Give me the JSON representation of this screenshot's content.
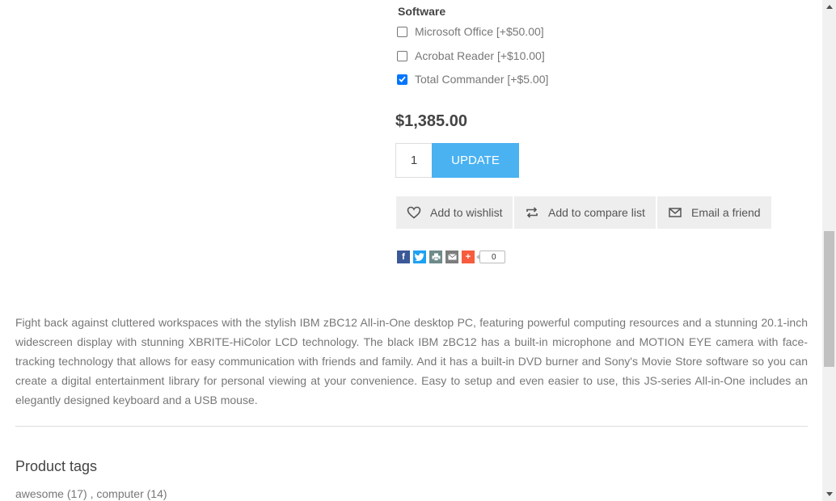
{
  "software": {
    "title": "Software",
    "options": [
      {
        "label": "Microsoft Office [+$50.00]",
        "checked": false
      },
      {
        "label": "Acrobat Reader [+$10.00]",
        "checked": false
      },
      {
        "label": "Total Commander [+$5.00]",
        "checked": true
      }
    ]
  },
  "price": "$1,385.00",
  "quantity": "1",
  "update_label": "UPDATE",
  "actions": {
    "wishlist": "Add to wishlist",
    "compare": "Add to compare list",
    "email": "Email a friend"
  },
  "share": {
    "count": "0",
    "colors": {
      "facebook": "#3b5998",
      "twitter": "#1da1f2",
      "print": "#6f8a8a",
      "email": "#7d7d7d",
      "more": "#f65c3d"
    }
  },
  "description": "Fight back against cluttered workspaces with the stylish IBM zBC12 All-in-One desktop PC, featuring powerful computing resources and a stunning 20.1-inch widescreen display with stunning XBRITE-HiColor LCD technology. The black IBM zBC12 has a built-in microphone and MOTION EYE camera with face-tracking technology that allows for easy communication with friends and family. And it has a built-in DVD burner and Sony's Movie Store software so you can create a digital entertainment library for personal viewing at your convenience. Easy to setup and even easier to use, this JS-series All-in-One includes an elegantly designed keyboard and a USB mouse.",
  "tags": {
    "title": "Product tags",
    "items": [
      {
        "label": "awesome",
        "count": "(17)"
      },
      {
        "label": "computer",
        "count": "(14)"
      }
    ],
    "separator": " , "
  }
}
